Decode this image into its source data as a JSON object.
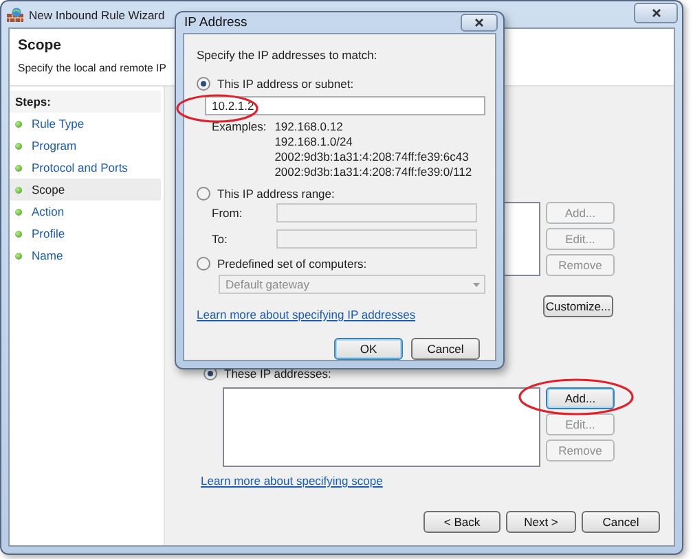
{
  "window": {
    "title": "New Inbound Rule Wizard"
  },
  "header": {
    "title": "Scope",
    "subtitle": "Specify the local and remote IP"
  },
  "steps": {
    "heading": "Steps:",
    "items": [
      {
        "label": "Rule Type",
        "selected": false
      },
      {
        "label": "Program",
        "selected": false
      },
      {
        "label": "Protocol and Ports",
        "selected": false
      },
      {
        "label": "Scope",
        "selected": true
      },
      {
        "label": "Action",
        "selected": false
      },
      {
        "label": "Profile",
        "selected": false
      },
      {
        "label": "Name",
        "selected": false
      }
    ]
  },
  "local_addresses": {
    "buttons": [
      {
        "label": "Add...",
        "disabled": true
      },
      {
        "label": "Edit...",
        "disabled": true
      },
      {
        "label": "Remove",
        "disabled": true
      }
    ],
    "customize": {
      "label": "Customize...",
      "disabled": false
    }
  },
  "remote_addresses": {
    "option": {
      "label": "These IP addresses:",
      "selected": true
    },
    "buttons": [
      {
        "label": "Add...",
        "disabled": false
      },
      {
        "label": "Edit...",
        "disabled": true
      },
      {
        "label": "Remove",
        "disabled": true
      }
    ],
    "link": "Learn more about specifying scope"
  },
  "nav_buttons": [
    {
      "label": "< Back"
    },
    {
      "label": "Next >"
    },
    {
      "label": "Cancel"
    }
  ],
  "dialog": {
    "title": "IP Address",
    "prompt": "Specify the IP addresses to match:",
    "options": [
      {
        "label": "This IP address or subnet:",
        "selected": true
      },
      {
        "label": "This IP address range:",
        "selected": false
      },
      {
        "label": "Predefined set of computers:",
        "selected": false
      }
    ],
    "address": {
      "value": "10.2.1.2"
    },
    "examples_label": "Examples:",
    "examples": [
      "192.168.0.12",
      "192.168.1.0/24",
      "2002:9d3b:1a31:4:208:74ff:fe39:6c43",
      "2002:9d3b:1a31:4:208:74ff:fe39:0/112"
    ],
    "range": {
      "from_label": "From:",
      "to_label": "To:",
      "disabled": true
    },
    "predefined": {
      "value": "Default gateway",
      "disabled": true
    },
    "link": "Learn more about specifying IP addresses",
    "buttons": [
      {
        "label": "OK",
        "default": true
      },
      {
        "label": "Cancel",
        "default": false
      }
    ]
  }
}
